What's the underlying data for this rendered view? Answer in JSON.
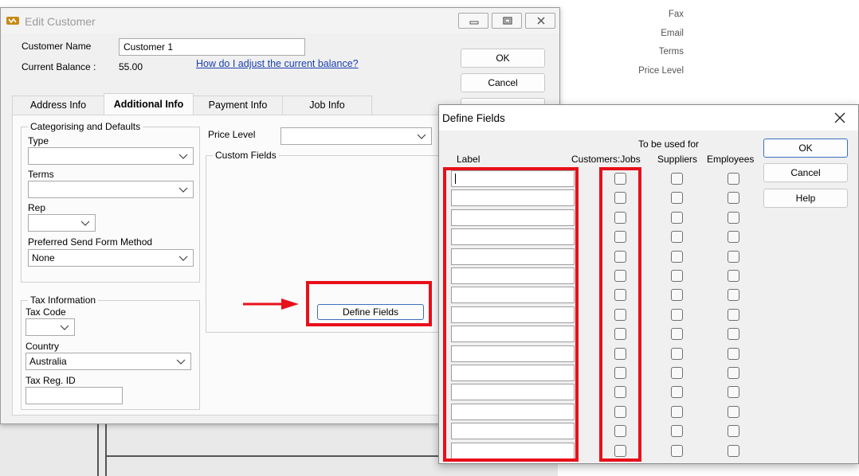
{
  "background": {
    "fields": [
      "Fax",
      "Email",
      "Terms",
      "Price Level"
    ]
  },
  "edit_customer": {
    "title": "Edit Customer",
    "customer_name_label": "Customer Name",
    "customer_name_value": "Customer 1",
    "current_balance_label": "Current Balance :",
    "current_balance_value": "55.00",
    "adjust_balance_link": "How do I adjust the current balance?",
    "ok_label": "OK",
    "cancel_label": "Cancel",
    "tabs": [
      "Address Info",
      "Additional Info",
      "Payment Info",
      "Job Info"
    ],
    "active_tab": "Additional Info",
    "categorising": {
      "title": "Categorising and Defaults",
      "type_label": "Type",
      "type_value": "",
      "terms_label": "Terms",
      "terms_value": "",
      "rep_label": "Rep",
      "rep_value": "",
      "send_method_label": "Preferred Send Form Method",
      "send_method_value": "None"
    },
    "tax": {
      "title": "Tax Information",
      "tax_code_label": "Tax Code",
      "tax_code_value": "",
      "country_label": "Country",
      "country_value": "Australia",
      "tax_reg_label": "Tax Reg. ID",
      "tax_reg_value": ""
    },
    "price_level_label": "Price Level",
    "price_level_value": "",
    "custom_fields_title": "Custom Fields",
    "define_fields_button": "Define Fields"
  },
  "define_fields": {
    "title": "Define Fields",
    "used_for_header": "To be used for",
    "columns": {
      "label": "Label",
      "customers_jobs": "Customers:Jobs",
      "suppliers": "Suppliers",
      "employees": "Employees"
    },
    "row_count": 15,
    "ok_label": "OK",
    "cancel_label": "Cancel",
    "help_label": "Help"
  },
  "colors": {
    "highlight": "#e8101a",
    "link": "#1a3fb0"
  },
  "icons": [
    "app-icon",
    "minimize-icon",
    "maximize-icon",
    "close-icon",
    "chevron-down-icon",
    "arrow-right-icon",
    "checkbox-icon"
  ]
}
